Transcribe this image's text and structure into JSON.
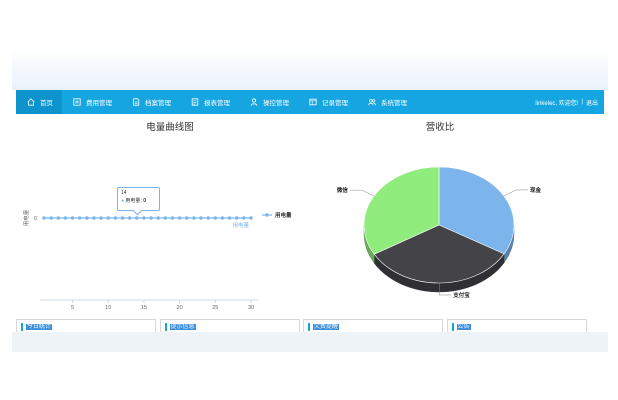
{
  "nav": {
    "items": [
      {
        "label": "首页",
        "icon": "home-icon"
      },
      {
        "label": "费用管理",
        "icon": "billing-icon"
      },
      {
        "label": "档案管理",
        "icon": "archive-icon"
      },
      {
        "label": "报表管理",
        "icon": "report-icon"
      },
      {
        "label": "操控管理",
        "icon": "user-control-icon"
      },
      {
        "label": "记录管理",
        "icon": "record-icon"
      },
      {
        "label": "系统管理",
        "icon": "system-users-icon"
      }
    ],
    "welcome": "linkelec, 欢迎您!",
    "separator": "|",
    "logout": "退出",
    "color": "#15a5e0"
  },
  "line_chart": {
    "title": "电量曲线图",
    "tooltip": {
      "x": "14",
      "series": "用电量",
      "value": "0"
    }
  },
  "pie_chart": {
    "title": "营收比"
  },
  "panels": [
    {
      "title": "今日统计"
    },
    {
      "title": "提示信息"
    },
    {
      "title": "欠费提醒"
    },
    {
      "title": "公告"
    }
  ],
  "chart_data": [
    {
      "type": "line",
      "title": "电量曲线图",
      "xlabel": "",
      "ylabel": "用电量",
      "x": [
        1,
        2,
        3,
        4,
        5,
        6,
        7,
        8,
        9,
        10,
        11,
        12,
        13,
        14,
        15,
        16,
        17,
        18,
        19,
        20,
        21,
        22,
        23,
        24,
        25,
        26,
        27,
        28,
        29,
        30
      ],
      "x_ticks": [
        5,
        10,
        15,
        20,
        25,
        30
      ],
      "y_ticks": [
        0
      ],
      "xlim": [
        1,
        30
      ],
      "series": [
        {
          "name": "用电量",
          "values": [
            0,
            0,
            0,
            0,
            0,
            0,
            0,
            0,
            0,
            0,
            0,
            0,
            0,
            0,
            0,
            0,
            0,
            0,
            0,
            0,
            0,
            0,
            0,
            0,
            0,
            0,
            0,
            0,
            0,
            0
          ],
          "color": "#7cb5ec"
        }
      ],
      "series_end_label": "用电量",
      "legend": "right",
      "grid": false
    },
    {
      "type": "pie",
      "title": "营收比",
      "slices": [
        {
          "label": "现金",
          "value": 33.3,
          "color": "#7cb5ec"
        },
        {
          "label": "支付宝",
          "value": 33.3,
          "color": "#434348"
        },
        {
          "label": "微信",
          "value": 33.4,
          "color": "#90ed7d"
        }
      ],
      "legend": "none"
    }
  ]
}
